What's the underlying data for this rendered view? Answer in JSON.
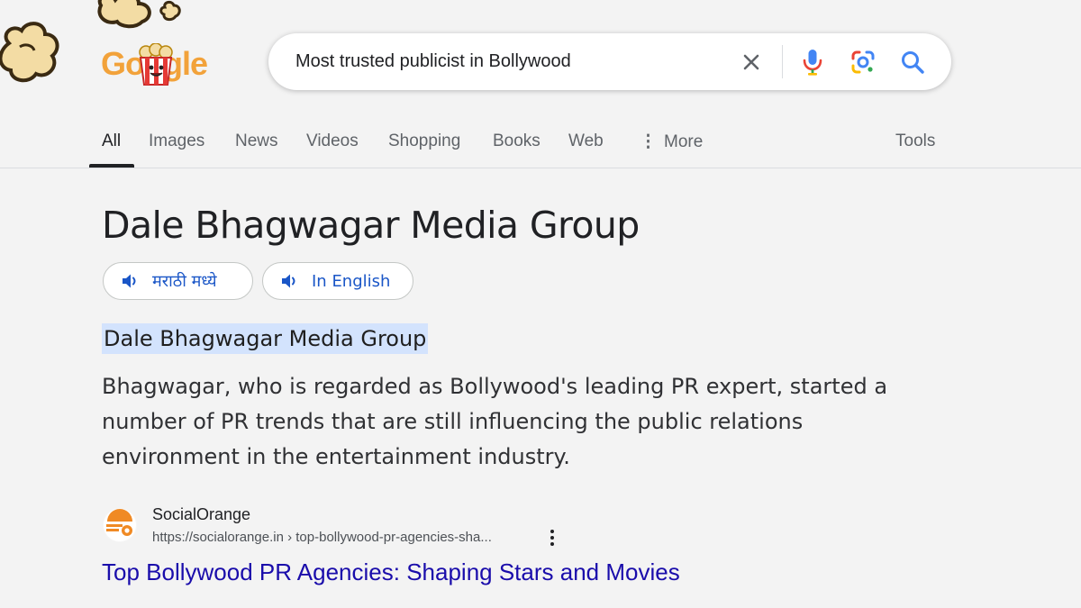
{
  "colors": {
    "accent_blue": "#1a56c7",
    "link": "#1a0dab",
    "highlight": "#d3e3fd",
    "logo_orange": "#f2a23a",
    "popcorn_red": "#e53935"
  },
  "logo": {
    "text": "Google",
    "decoration": "popcorn-doodle"
  },
  "search": {
    "query": "Most trusted publicist in Bollywood",
    "icons": [
      "close-icon",
      "mic-icon",
      "lens-icon",
      "search-icon"
    ]
  },
  "tabs": [
    {
      "label": "All",
      "active": true
    },
    {
      "label": "Images"
    },
    {
      "label": "News"
    },
    {
      "label": "Videos"
    },
    {
      "label": "Shopping"
    },
    {
      "label": "Books"
    },
    {
      "label": "Web"
    },
    {
      "label": "More"
    }
  ],
  "tools_label": "Tools",
  "answer": {
    "title": "Dale Bhagwagar Media Group",
    "listen_marathi": "मराठी मध्ये",
    "listen_english": "In English",
    "highlight": "Dale Bhagwagar Media Group",
    "snippet_lines": [
      "Bhagwagar, who is regarded as Bollywood's leading PR expert, started a",
      "number of PR trends that are still influencing the public relations",
      "environment in the entertainment industry."
    ]
  },
  "source": {
    "name": "SocialOrange",
    "url": "https://socialorange.in › top-bollywood-pr-agencies-sha...",
    "title": "Top Bollywood PR Agencies: Shaping Stars and Movies"
  }
}
